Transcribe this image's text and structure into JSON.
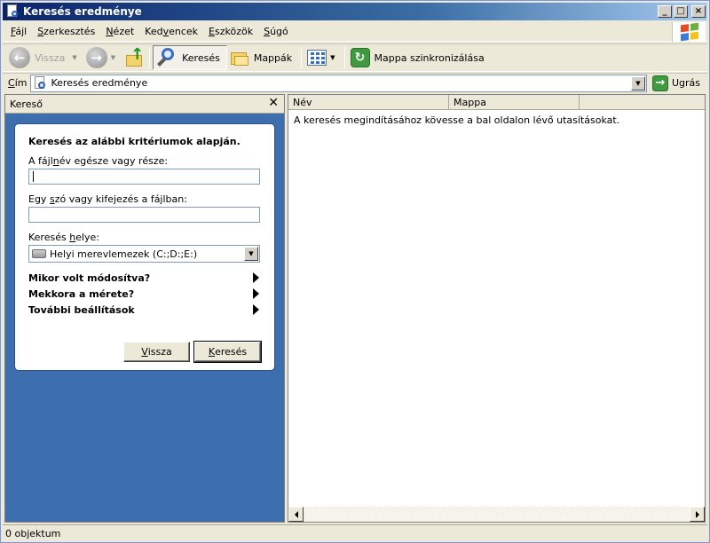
{
  "window": {
    "title": "Keresés eredménye"
  },
  "menu": {
    "items": [
      {
        "pre": "",
        "u": "F",
        "post": "ájl"
      },
      {
        "pre": "",
        "u": "S",
        "post": "zerkesztés"
      },
      {
        "pre": "",
        "u": "N",
        "post": "ézet"
      },
      {
        "pre": "Ked",
        "u": "v",
        "post": "encek"
      },
      {
        "pre": "",
        "u": "E",
        "post": "szközök"
      },
      {
        "pre": "",
        "u": "S",
        "post": "úgó"
      }
    ]
  },
  "toolbar": {
    "back_label": "Vissza",
    "search_label": "Keresés",
    "folders_label": "Mappák",
    "sync_label": "Mappa szinkronizálása"
  },
  "address": {
    "label_u": "C",
    "label_rest": "ím",
    "value": "Keresés eredménye",
    "go_label": "Ugrás"
  },
  "search_pane": {
    "title": "Kereső",
    "heading": "Keresés az alábbi kritériumok alapján.",
    "filename_label_pre": "A fájl",
    "filename_label_u": "n",
    "filename_label_post": "év egésze vagy része:",
    "filename_value": "",
    "phrase_label_pre": "Egy ",
    "phrase_label_u": "s",
    "phrase_label_post": "zó vagy kifejezés a fájlban:",
    "phrase_value": "",
    "location_label_pre": "Keresés ",
    "location_label_u": "h",
    "location_label_post": "elye:",
    "location_value": "Helyi merevlemezek (C:;D:;E:)",
    "options": [
      "Mikor volt módosítva?",
      "Mekkora a mérete?",
      "További beállítások"
    ],
    "back_button_u": "V",
    "back_button_rest": "issza",
    "search_button_u": "K",
    "search_button_rest": "eresés"
  },
  "results": {
    "columns": [
      "Név",
      "Mappa"
    ],
    "hint": "A keresés megindításához kövesse a bal oldalon lévő utasításokat."
  },
  "status": {
    "text": "0 objektum"
  }
}
